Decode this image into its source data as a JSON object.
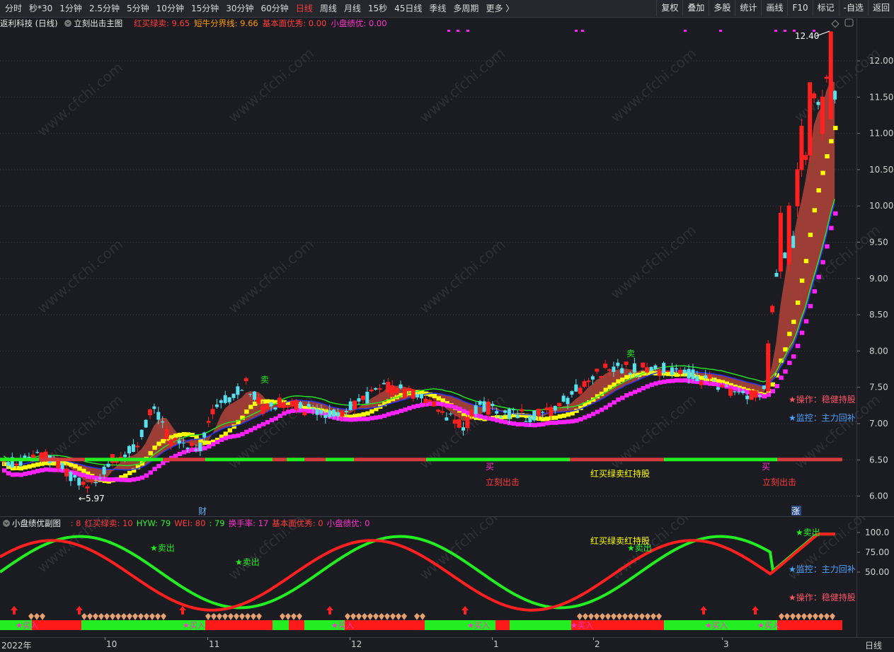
{
  "toolbar": {
    "timeframes": [
      "分时",
      "秒*30",
      "1分钟",
      "2.5分钟",
      "5分钟",
      "10分钟",
      "15分钟",
      "30分钟",
      "60分钟",
      "日线",
      "周线",
      "月线",
      "15秒",
      "45日线",
      "季线",
      "多周期",
      "更多 〉"
    ],
    "active_index": 9,
    "buttons": [
      "复权",
      "叠加",
      "多股",
      "统计",
      "画线",
      "F10",
      "标记",
      "-自选",
      "返回"
    ]
  },
  "main": {
    "stock_title": "返利科技 (日线)",
    "indicator_name": "立刻出击主图",
    "readouts": [
      {
        "text": "红买绿卖: 9.65",
        "color": "#ff3b3b"
      },
      {
        "text": "短牛分界线: 9.66",
        "color": "#ff9900"
      },
      {
        "text": "基本面优秀: 0.00",
        "color": "#ff3b3b"
      },
      {
        "text": "小盘绩优: 0.00",
        "color": "#ff33cc"
      }
    ],
    "price_ticks": [
      "12.00",
      "11.50",
      "11.00",
      "10.50",
      "10.00",
      "9.50",
      "9.00",
      "8.50",
      "8.00",
      "7.50",
      "7.00",
      "6.50",
      "6.00"
    ],
    "high_label": "12.40",
    "low_label": "←5.97",
    "annotations": {
      "sell1": "卖",
      "sell2": "卖",
      "buy_mark1": "买",
      "buy_mark2": "买",
      "attack1": "立刻出击",
      "attack2": "立刻出击",
      "hold": "红买绿卖红持股",
      "op": "★操作：稳健持股",
      "monitor": "★监控：主力回补",
      "cai": "财",
      "zhang": "涨"
    },
    "watermark": "www.cfchi.com"
  },
  "sub": {
    "title": "小盘绩优副图",
    "readouts": [
      {
        "text": ": 8",
        "color": "#ff3b3b"
      },
      {
        "text": "红买绿卖: 10",
        "color": "#ff3b3b"
      },
      {
        "text": "HYW: 79",
        "color": "#33ee33"
      },
      {
        "text": "WEI: 80",
        "color": "#ff3b3b"
      },
      {
        "text": ": 79",
        "color": "#33ee33"
      },
      {
        "text": "换手率: 17",
        "color": "#ff33cc"
      },
      {
        "text": "基本面优秀: 0",
        "color": "#ff3b3b"
      },
      {
        "text": "小盘绩优: 0",
        "color": "#ff33cc"
      }
    ],
    "ticks": [
      "100.0",
      "75.00",
      "50.00"
    ],
    "labels": {
      "sell": "★卖出",
      "buy": "★买入",
      "hold": "红买绿卖红持股",
      "monitor": "★监控：主力回补",
      "op": "★操作：稳健持股"
    }
  },
  "date_axis": {
    "labels": [
      "2022年",
      "10",
      "11",
      "12",
      "1",
      "2",
      "3"
    ],
    "period": "日线"
  },
  "colors": {
    "up": "#ff2020",
    "down": "#56e0f0",
    "bg": "#1b1c21",
    "yellow": "#ffff00",
    "magenta": "#ff22ff",
    "green": "#22ee22",
    "blue": "#2233ff"
  },
  "icons": {
    "indicator_toggle": "circle-check-icon",
    "settings": "gear-icon",
    "diamond": "diamond-icon"
  }
}
